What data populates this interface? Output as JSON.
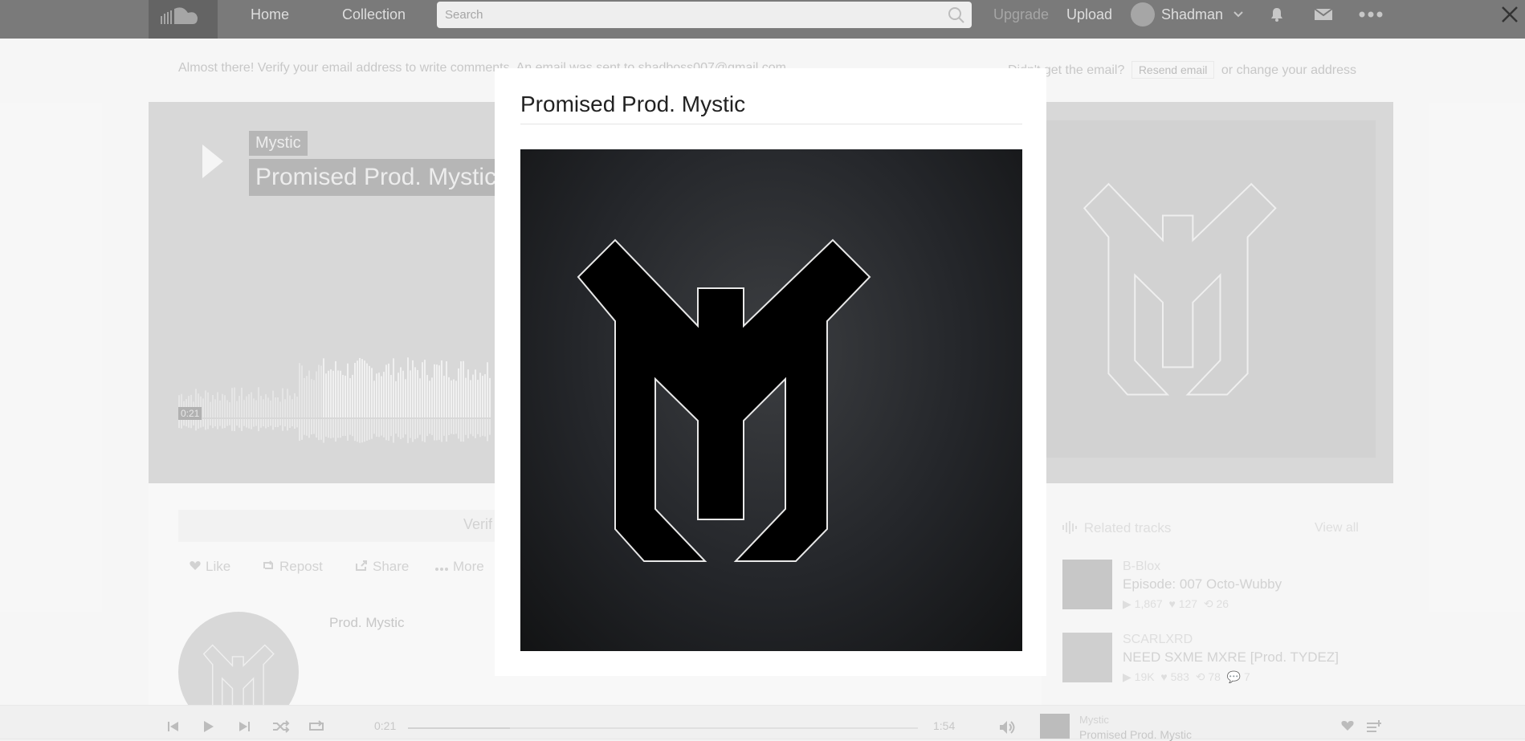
{
  "header": {
    "nav": [
      "Home",
      "Collection"
    ],
    "search_placeholder": "Search",
    "upgrade": "Upgrade",
    "upload": "Upload",
    "username": "Shadman"
  },
  "verify_banner": {
    "text": "Almost there! Verify your email address to write comments. An email was sent to shadboss007@gmail.com",
    "didnt_get": "Didn't get the email?",
    "resend": "Resend email",
    "or": "or",
    "change": "change your address"
  },
  "hero": {
    "artist": "Mystic",
    "title": "Promised Prod. Mystic",
    "current_time": "0:21"
  },
  "track_actions": {
    "verify_text": "Verif",
    "like": "Like",
    "repost": "Repost",
    "share": "Share",
    "more": "More"
  },
  "uploader": {
    "name": "Prod. Mystic"
  },
  "related": {
    "heading": "Related tracks",
    "view_all": "View all",
    "items": [
      {
        "artist": "B-Blox",
        "title": "Episode: 007 Octo-Wubby",
        "plays": "1,867",
        "likes": "127",
        "reposts": "26",
        "comments": ""
      },
      {
        "artist": "SCARLXRD",
        "title": "NEED SXME MXRE [Prod. TYDEZ]",
        "plays": "19K",
        "likes": "583",
        "reposts": "78",
        "comments": "7"
      }
    ]
  },
  "player": {
    "elapsed": "0:21",
    "duration": "1:54",
    "progress_fraction": 0.2,
    "artist": "Mystic",
    "title": "Promised Prod. Mystic"
  },
  "modal": {
    "title": "Promised Prod. Mystic"
  }
}
